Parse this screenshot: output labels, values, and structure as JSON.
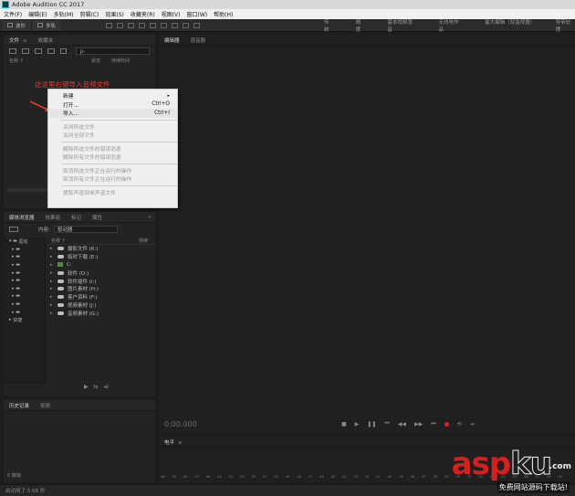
{
  "window": {
    "title": "Adobe Audition CC 2017"
  },
  "menu": [
    "文件(F)",
    "编辑(E)",
    "多轨(M)",
    "剪辑(C)",
    "效果(S)",
    "收藏夹(R)",
    "视图(V)",
    "窗口(W)",
    "帮助(H)"
  ],
  "toolbar": {
    "waveform_label": "波形",
    "multitrack_label": "多轨",
    "workspaces": [
      "传统",
      "精度",
      "基本视频混音",
      "无线电作品",
      "最大编辑（双监视器）",
      "导带处理"
    ]
  },
  "files_panel": {
    "tabs": [
      "文件",
      "收藏夹"
    ],
    "search_glyph": "ρ-",
    "columns": [
      "名称 ↑",
      "状态",
      "持续时间"
    ],
    "annotation": "这这里右键导入音频文件"
  },
  "context_menu": {
    "items": [
      {
        "label": "新建",
        "shortcut": "",
        "submenu": "▸",
        "enabled": true
      },
      {
        "label": "打开...",
        "shortcut": "Ctrl+O",
        "submenu": "",
        "enabled": true
      },
      {
        "label": "导入...",
        "shortcut": "Ctrl+I",
        "submenu": "",
        "enabled": true
      },
      {
        "label": "关闭所选文件",
        "shortcut": "",
        "submenu": "",
        "enabled": false
      },
      {
        "label": "关闭全部文件",
        "shortcut": "",
        "submenu": "",
        "enabled": false
      },
      {
        "label": "解除所选文件的错误消息",
        "shortcut": "",
        "submenu": "",
        "enabled": false
      },
      {
        "label": "解除所有文件的错误消息",
        "shortcut": "",
        "submenu": "",
        "enabled": false
      },
      {
        "label": "取消所选文件正在运行的操作",
        "shortcut": "",
        "submenu": "",
        "enabled": false
      },
      {
        "label": "取消所有文件正在运行的操作",
        "shortcut": "",
        "submenu": "",
        "enabled": false
      },
      {
        "label": "提取声道到单声道文件",
        "shortcut": "",
        "submenu": "",
        "enabled": false
      }
    ]
  },
  "media_panel": {
    "tabs": [
      "媒体浏览器",
      "效果组",
      "标记",
      "属性"
    ],
    "content_label": "内容:",
    "content_value": "驱动器",
    "tree": [
      "驱动",
      "",
      "",
      "",
      "",
      "",
      "",
      "",
      "",
      "",
      "快捷"
    ],
    "list_header_name": "名称 ↑",
    "list_header_dur": "持续",
    "drives": [
      "摄影文件 (K:)",
      "临时下载 (E:)",
      "C:",
      "软件 (D:)",
      "软件插件 (I:)",
      "图片素材 (H:)",
      "客户资料 (F:)",
      "视频素材 (J:)",
      "音频素材 (G:)"
    ],
    "controls": [
      "▶",
      "⇆",
      "◂)"
    ]
  },
  "history_panel": {
    "tabs": [
      "历史记录",
      "视频"
    ],
    "footer": "0 撤销"
  },
  "editor_panel": {
    "tabs": [
      "编辑器",
      "混音器"
    ],
    "timecode": "0:00.000",
    "transport": [
      "■",
      "▶",
      "❚❚",
      "⏮",
      "◀◀",
      "▶▶",
      "⏭",
      "⟲",
      "⇥"
    ]
  },
  "level_panel": {
    "title": "电平",
    "ruler": [
      "dB",
      "-59",
      "-58",
      "-57",
      "-56",
      "-55",
      "-54",
      "-53",
      "-52",
      "-51",
      "-50",
      "-49",
      "-48",
      "-47",
      "-46",
      "-45",
      "-44",
      "-43",
      "-42",
      "-41",
      "-40",
      "-39",
      "-38",
      "-37",
      "-36",
      "-35",
      "-34",
      "-33",
      "-32",
      "-31",
      "-30",
      "-29",
      "-28",
      "-27",
      "-26",
      "-25"
    ]
  },
  "status": {
    "text": "启动用了 5.68 秒"
  },
  "watermark": {
    "brand_a": "asp",
    "brand_b": "ku",
    "brand_c": ".com",
    "sub": "免费网站源码下载站!"
  },
  "colors": {
    "annotation": "#e03a2f",
    "record": "#d6252a",
    "brand": "#d91e1e"
  }
}
